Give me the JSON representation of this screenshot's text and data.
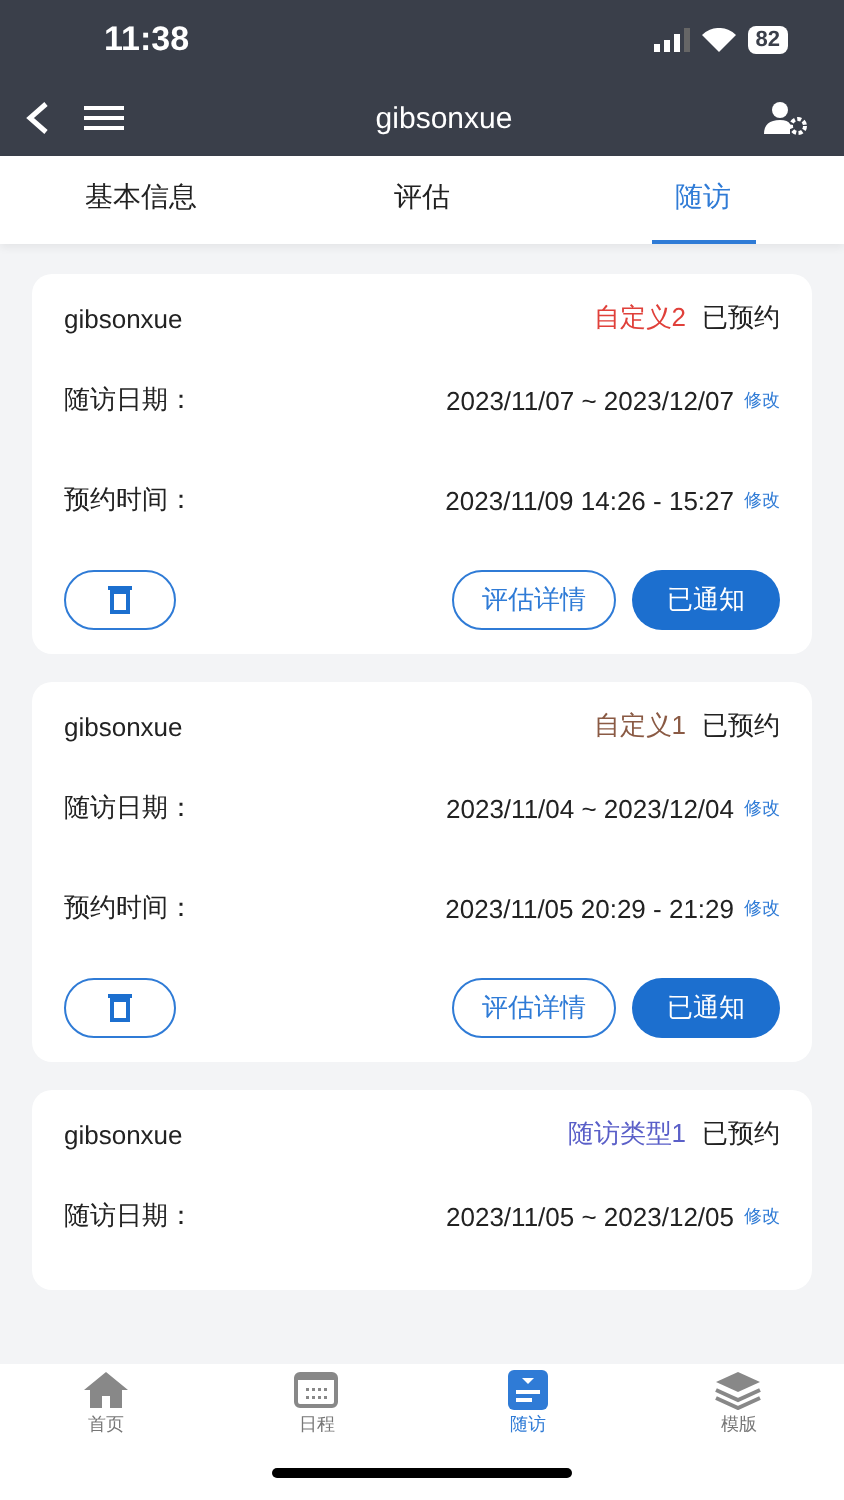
{
  "status_bar": {
    "time": "11:38",
    "battery": "82"
  },
  "nav": {
    "title": "gibsonxue"
  },
  "tabs": [
    {
      "label": "基本信息",
      "selected": false
    },
    {
      "label": "评估",
      "selected": false
    },
    {
      "label": "随访",
      "selected": true
    }
  ],
  "cards": [
    {
      "name": "gibsonxue",
      "type": "自定义2",
      "color": "#e0403a",
      "status": "已预约",
      "rows": [
        {
          "label": "随访日期：",
          "value": "2023/11/07 ~ 2023/12/07",
          "link": "修改"
        },
        {
          "label": "预约时间：",
          "value": "2023/11/09 14:26 - 15:27",
          "link": "修改"
        }
      ],
      "buttons": {
        "detail": "评估详情",
        "notify": "已通知"
      }
    },
    {
      "name": "gibsonxue",
      "type": "自定义1",
      "color": "#8a5a44",
      "status": "已预约",
      "rows": [
        {
          "label": "随访日期：",
          "value": "2023/11/04 ~ 2023/12/04",
          "link": "修改"
        },
        {
          "label": "预约时间：",
          "value": "2023/11/05 20:29 - 21:29",
          "link": "修改"
        }
      ],
      "buttons": {
        "detail": "评估详情",
        "notify": "已通知"
      }
    },
    {
      "name": "gibsonxue",
      "type": "随访类型1",
      "color": "#5a5fc8",
      "status": "已预约",
      "rows": [
        {
          "label": "随访日期：",
          "value": "2023/11/05 ~ 2023/12/05",
          "link": "修改"
        }
      ]
    }
  ],
  "bottom_tabs": [
    {
      "label": "首页",
      "kind": "home",
      "selected": false
    },
    {
      "label": "日程",
      "kind": "calendar",
      "selected": false
    },
    {
      "label": "随访",
      "kind": "followup",
      "selected": true
    },
    {
      "label": "模版",
      "kind": "layers",
      "selected": false
    }
  ]
}
